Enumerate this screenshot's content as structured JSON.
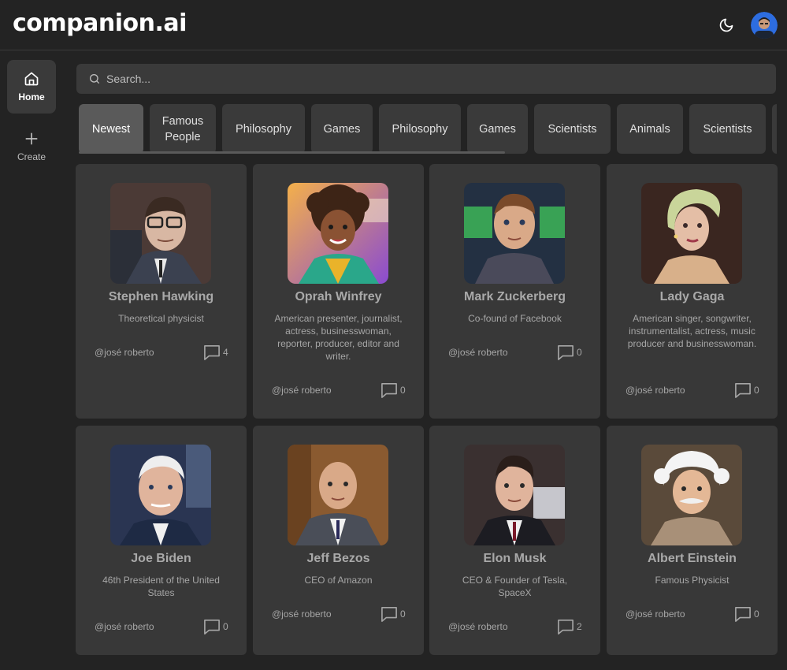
{
  "app": {
    "logo": "companion.ai"
  },
  "header": {
    "theme_icon": "moon-icon",
    "avatar_icon": "user-avatar"
  },
  "sidebar": {
    "items": [
      {
        "label": "Home",
        "icon": "home-icon",
        "active": true
      },
      {
        "label": "Create",
        "icon": "plus-icon",
        "active": false
      }
    ]
  },
  "search": {
    "placeholder": "Search...",
    "value": ""
  },
  "categories": [
    "Newest",
    "Famous People",
    "Philosophy",
    "Games",
    "Philosophy",
    "Games",
    "Scientists",
    "Animals",
    "Scientists"
  ],
  "companions": [
    {
      "name": "Stephen Hawking",
      "description": "Theoretical physicist",
      "author": "@josé roberto",
      "messages": "4"
    },
    {
      "name": "Oprah Winfrey",
      "description": "American presenter, journalist, actress, businesswoman, reporter, producer, editor and writer.",
      "author": "@josé roberto",
      "messages": "0"
    },
    {
      "name": "Mark Zuckerberg",
      "description": "Co-found of Facebook",
      "author": "@josé roberto",
      "messages": "0"
    },
    {
      "name": "Lady Gaga",
      "description": "American singer, songwriter, instrumentalist, actress, music producer and businesswoman.",
      "author": "@josé roberto",
      "messages": "0"
    },
    {
      "name": "Joe Biden",
      "description": "46th President of the United States",
      "author": "@josé roberto",
      "messages": "0"
    },
    {
      "name": "Jeff Bezos",
      "description": "CEO of Amazon",
      "author": "@josé roberto",
      "messages": "0"
    },
    {
      "name": "Elon Musk",
      "description": "CEO & Founder of Tesla, SpaceX",
      "author": "@josé roberto",
      "messages": "2"
    },
    {
      "name": "Albert Einstein",
      "description": "Famous Physicist",
      "author": "@josé roberto",
      "messages": "0"
    }
  ],
  "colors": {
    "background": "#232323",
    "card": "#383838",
    "active_tab": "#5a5a5a"
  }
}
